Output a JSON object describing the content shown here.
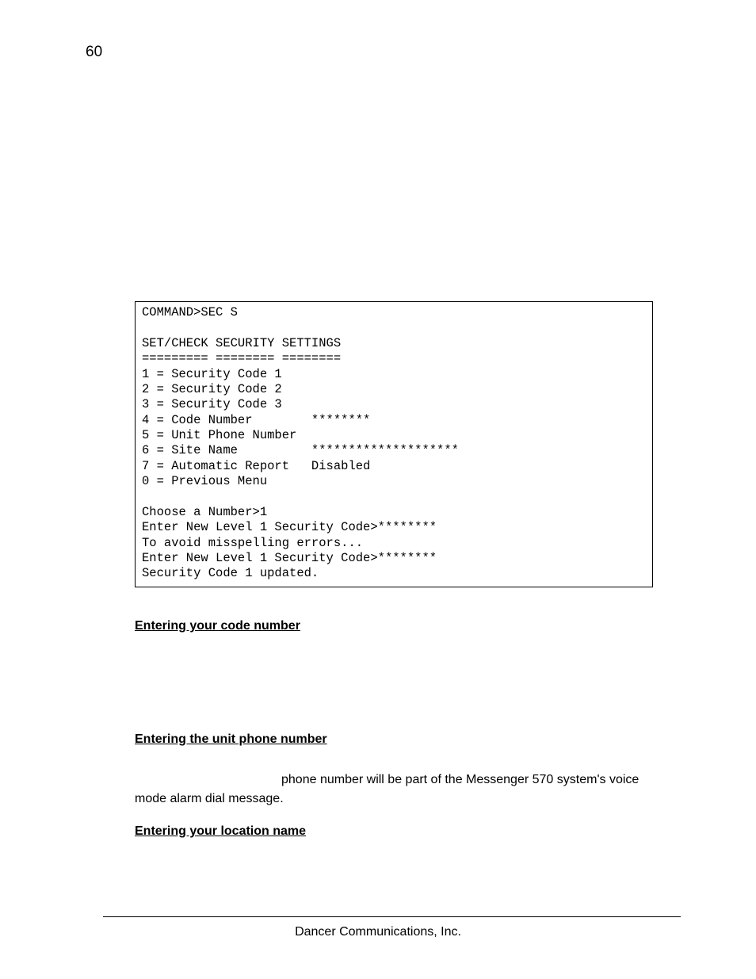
{
  "pageNumber": "60",
  "terminal": {
    "line01": "COMMAND>SEC S",
    "blank1": "",
    "line02": "SET/CHECK SECURITY SETTINGS",
    "line03": "========= ======== ========",
    "line04": "1 = Security Code 1",
    "line05": "2 = Security Code 2",
    "line06": "3 = Security Code 3",
    "line07": "4 = Code Number        ********",
    "line08": "5 = Unit Phone Number",
    "line09": "6 = Site Name          ********************",
    "line10": "7 = Automatic Report   Disabled",
    "line11": "0 = Previous Menu",
    "blank2": "",
    "line12": "Choose a Number>1",
    "line13": "Enter New Level 1 Security Code>********",
    "line14": "To avoid misspelling errors...",
    "line15": "Enter New Level 1 Security Code>********",
    "line16": "Security Code 1 updated."
  },
  "headings": {
    "codeNumber": "Entering your code number",
    "unitPhone": "Entering the unit phone number",
    "locationName": "Entering your location name"
  },
  "bodyTexts": {
    "phoneFragment": "phone number will be part of the Messenger 570 system's voice mode alarm dial message."
  },
  "footer": "Dancer Communications, Inc."
}
